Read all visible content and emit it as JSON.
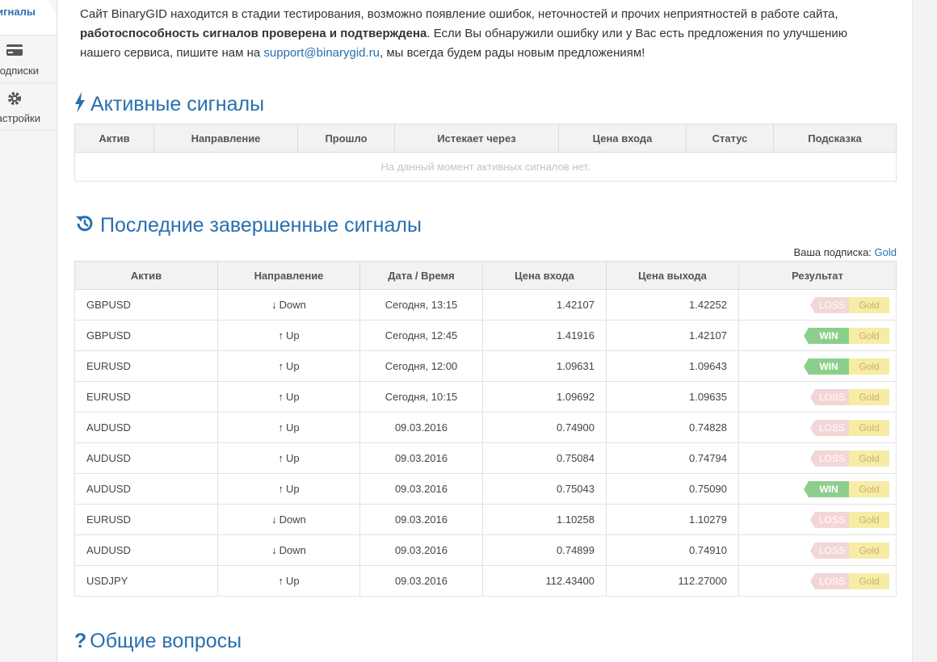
{
  "sidebar": {
    "items": [
      {
        "label": "Сигналы",
        "icon": "chart-line-icon",
        "active": true
      },
      {
        "label": "Подписки",
        "icon": "credit-card-icon",
        "active": false
      },
      {
        "label": "Настройки",
        "icon": "gear-icon",
        "active": false
      }
    ]
  },
  "notice": {
    "part1": "Сайт BinaryGID находится в стадии тестирования, возможно появление ошибок, неточностей и прочих неприятностей в работе сайта, ",
    "bold": "работоспособность сигналов проверена и подтверждена",
    "part2": ". Если Вы обнаружили ошибку или у Вас есть предложения по улучшению нашего сервиса, пишите нам на ",
    "email": "support@binarygid.ru",
    "part3": ", мы всегда будем рады новым предложениям!"
  },
  "active_signals": {
    "title": "Активные сигналы",
    "columns": [
      "Актив",
      "Направление",
      "Прошло",
      "Истекает через",
      "Цена входа",
      "Статус",
      "Подсказка"
    ],
    "empty_text": "На данный момент активных сигналов нет."
  },
  "completed_signals": {
    "title": "Последние завершенные сигналы",
    "subscription_label": "Ваша подписка:",
    "subscription_value": "Gold",
    "columns": [
      "Актив",
      "Направление",
      "Дата / Время",
      "Цена входа",
      "Цена выхода",
      "Результат"
    ],
    "rows": [
      {
        "asset": "GBPUSD",
        "dir": "Down",
        "date": "Сегодня, 13:15",
        "entry": "1.42107",
        "exit": "1.42252",
        "result": "LOSS",
        "tier": "Gold"
      },
      {
        "asset": "GBPUSD",
        "dir": "Up",
        "date": "Сегодня, 12:45",
        "entry": "1.41916",
        "exit": "1.42107",
        "result": "WIN",
        "tier": "Gold"
      },
      {
        "asset": "EURUSD",
        "dir": "Up",
        "date": "Сегодня, 12:00",
        "entry": "1.09631",
        "exit": "1.09643",
        "result": "WIN",
        "tier": "Gold"
      },
      {
        "asset": "EURUSD",
        "dir": "Up",
        "date": "Сегодня, 10:15",
        "entry": "1.09692",
        "exit": "1.09635",
        "result": "LOSS",
        "tier": "Gold"
      },
      {
        "asset": "AUDUSD",
        "dir": "Up",
        "date": "09.03.2016",
        "entry": "0.74900",
        "exit": "0.74828",
        "result": "LOSS",
        "tier": "Gold"
      },
      {
        "asset": "AUDUSD",
        "dir": "Up",
        "date": "09.03.2016",
        "entry": "0.75084",
        "exit": "0.74794",
        "result": "LOSS",
        "tier": "Gold"
      },
      {
        "asset": "AUDUSD",
        "dir": "Up",
        "date": "09.03.2016",
        "entry": "0.75043",
        "exit": "0.75090",
        "result": "WIN",
        "tier": "Gold"
      },
      {
        "asset": "EURUSD",
        "dir": "Down",
        "date": "09.03.2016",
        "entry": "1.10258",
        "exit": "1.10279",
        "result": "LOSS",
        "tier": "Gold"
      },
      {
        "asset": "AUDUSD",
        "dir": "Down",
        "date": "09.03.2016",
        "entry": "0.74899",
        "exit": "0.74910",
        "result": "LOSS",
        "tier": "Gold"
      },
      {
        "asset": "USDJPY",
        "dir": "Up",
        "date": "09.03.2016",
        "entry": "112.43400",
        "exit": "112.27000",
        "result": "LOSS",
        "tier": "Gold"
      }
    ]
  },
  "faq": {
    "title": "Общие вопросы"
  },
  "colors": {
    "accent": "#2a6fb0",
    "win": "#8ccf8c",
    "loss": "#f3d6d6",
    "gold": "#f6eca6"
  }
}
